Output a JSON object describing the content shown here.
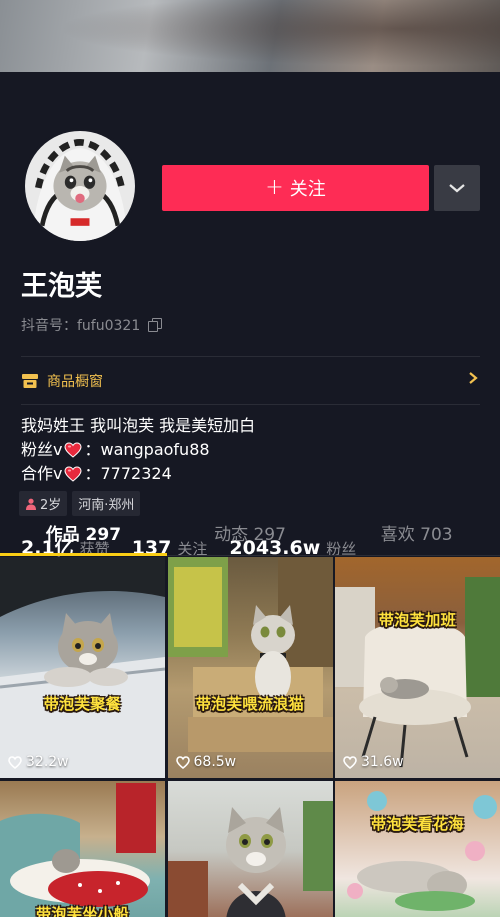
{
  "profile": {
    "follow_label": "关注",
    "nickname": "王泡芙",
    "douyin_id": "抖音号：fufu0321",
    "shop_label": "商品橱窗",
    "bio_line1": "我妈姓王 我叫泡芙 我是美短加白",
    "bio_fans_prefix": "粉丝v",
    "bio_fans_value": "：wangpaofu88",
    "bio_coop_prefix": "合作v",
    "bio_coop_value": "：7772324",
    "tag_age": "2岁",
    "tag_location": "河南·郑州"
  },
  "stats": {
    "likes_num": "2.1亿",
    "likes_label": "获赞",
    "following_num": "137",
    "following_label": "关注",
    "followers_num": "2043.6w",
    "followers_label": "粉丝"
  },
  "tabs": [
    {
      "label": "作品 297",
      "active": true
    },
    {
      "label": "动态 297",
      "active": false
    },
    {
      "label": "喜欢 703",
      "active": false
    }
  ],
  "videos": [
    {
      "caption": "带泡芙聚餐",
      "likes": "32.2w"
    },
    {
      "caption": "带泡芙喂流浪猫",
      "likes": "68.5w"
    },
    {
      "caption": "带泡芙加班",
      "likes": "31.6w"
    },
    {
      "caption": "带泡芙坐小船",
      "likes": ""
    },
    {
      "caption": "",
      "likes": ""
    },
    {
      "caption": "带泡芙看花海",
      "likes": ""
    }
  ],
  "icons": {
    "follow": "plus-icon",
    "more": "chevron-down-icon",
    "copy": "copy-icon",
    "shop": "shop-icon",
    "shop_arrow": "chevron-right-icon",
    "heart": "heart-icon",
    "gender": "female-icon",
    "likes": "heart-outline-icon"
  },
  "colors": {
    "background": "#161823",
    "follow_button": "#fe2c55",
    "shop_accent": "#f2c14f",
    "tab_indicator": "#face15",
    "caption": "#ffe23d"
  }
}
